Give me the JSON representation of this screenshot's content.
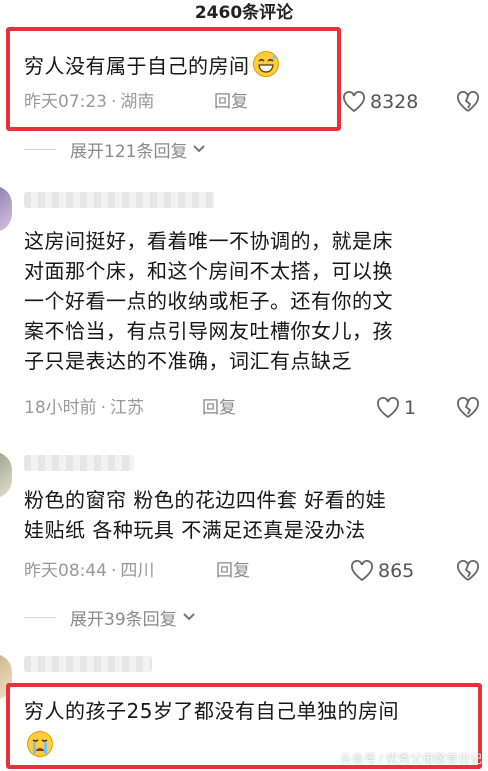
{
  "header": {
    "title": "2460条评论"
  },
  "comments": [
    {
      "text": "穷人没有属于自己的房间",
      "emoji": "grinning-sweat-emoji",
      "time": "昨天07:23",
      "location": "湖南",
      "reply_label": "回复",
      "likes": "8328",
      "expand_label": "展开121条回复"
    },
    {
      "lines": [
        "这房间挺好，看着唯一不协调的，就是床",
        "对面那个床，和这个房间不太搭，可以换",
        "一个好看一点的收纳或柜子。还有你的文",
        "案不恰当，有点引导网友吐槽你女儿，孩",
        "子只是表达的不准确，词汇有点缺乏"
      ],
      "time": "18小时前",
      "location": "江苏",
      "reply_label": "回复",
      "likes": "1"
    },
    {
      "lines": [
        "粉色的窗帘  粉色的花边四件套  好看的娃",
        "娃贴纸  各种玩具   不满足还真是没办法"
      ],
      "time": "昨天08:44",
      "location": "四川",
      "reply_label": "回复",
      "likes": "865",
      "expand_label": "展开39条回复"
    },
    {
      "text": "穷人的孩子25岁了都没有自己单独的房间",
      "emoji": "crying-face-emoji"
    }
  ],
  "colors": {
    "highlight": "#e8323a",
    "meta_text": "#999999"
  }
}
